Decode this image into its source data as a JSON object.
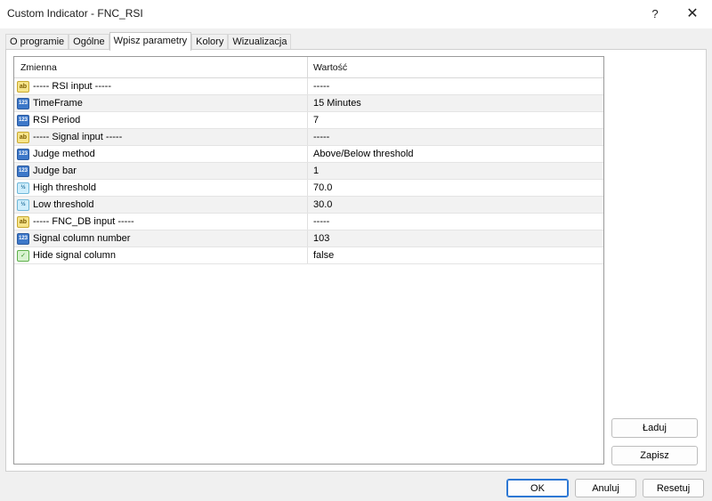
{
  "window": {
    "title": "Custom Indicator - FNC_RSI",
    "help_label": "?",
    "close_label": "✕"
  },
  "tabs": [
    {
      "label": "O programie",
      "active": false
    },
    {
      "label": "Ogólne",
      "active": false
    },
    {
      "label": "Wpisz parametry",
      "active": true
    },
    {
      "label": "Kolory",
      "active": false
    },
    {
      "label": "Wizualizacja",
      "active": false
    }
  ],
  "grid": {
    "headers": {
      "name": "Zmienna",
      "value": "Wartość"
    },
    "rows": [
      {
        "icon": "ab",
        "name": "----- RSI input -----",
        "value": "-----"
      },
      {
        "icon": "123",
        "name": "TimeFrame",
        "value": "15 Minutes"
      },
      {
        "icon": "123",
        "name": "RSI Period",
        "value": "7"
      },
      {
        "icon": "ab",
        "name": "----- Signal input -----",
        "value": "-----"
      },
      {
        "icon": "123",
        "name": "Judge method",
        "value": "Above/Below threshold"
      },
      {
        "icon": "123",
        "name": "Judge bar",
        "value": "1"
      },
      {
        "icon": "v2",
        "name": "High threshold",
        "value": "70.0"
      },
      {
        "icon": "v2",
        "name": "Low threshold",
        "value": "30.0"
      },
      {
        "icon": "ab",
        "name": "----- FNC_DB input -----",
        "value": "-----"
      },
      {
        "icon": "123",
        "name": "Signal column number",
        "value": "103"
      },
      {
        "icon": "bool",
        "name": "Hide signal column",
        "value": "false"
      }
    ]
  },
  "buttons": {
    "load": "Ładuj",
    "save": "Zapisz",
    "ok": "OK",
    "cancel": "Anuluj",
    "reset": "Resetuj"
  },
  "icon_glyphs": {
    "ab": "ab",
    "123": "123",
    "v2": "½",
    "bool": "✓"
  }
}
